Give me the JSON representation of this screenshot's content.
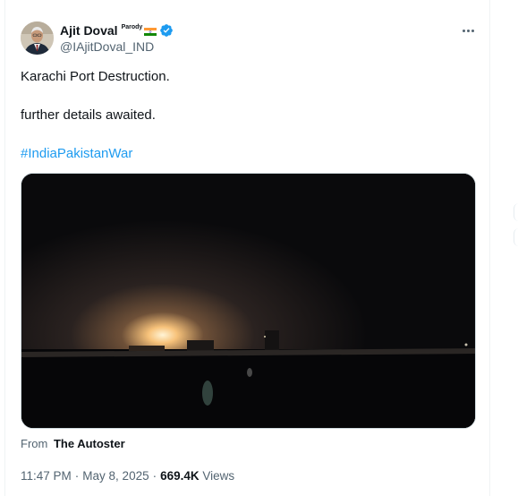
{
  "author": {
    "display_name": "Ajit Doval",
    "parody_label": "Parody",
    "handle": "@IAjitDoval_IND",
    "verified_color": "#1d9bf0"
  },
  "tweet": {
    "line_1": "Karachi Port Destruction.",
    "line_2": "further details awaited.",
    "hashtag": "#IndiaPakistanWar"
  },
  "media": {
    "kind": "video"
  },
  "source": {
    "prefix": "From",
    "name": "The Autoster"
  },
  "meta": {
    "time": "11:47 PM",
    "separator": "·",
    "date": "May 8, 2025",
    "views_count": "669.4K",
    "views_label": "Views"
  },
  "colors": {
    "accent": "#1d9bf0",
    "text_primary": "#0f1419",
    "text_secondary": "#536471"
  },
  "icons": [
    "more-icon",
    "verified-badge-icon",
    "india-flag-icon"
  ]
}
